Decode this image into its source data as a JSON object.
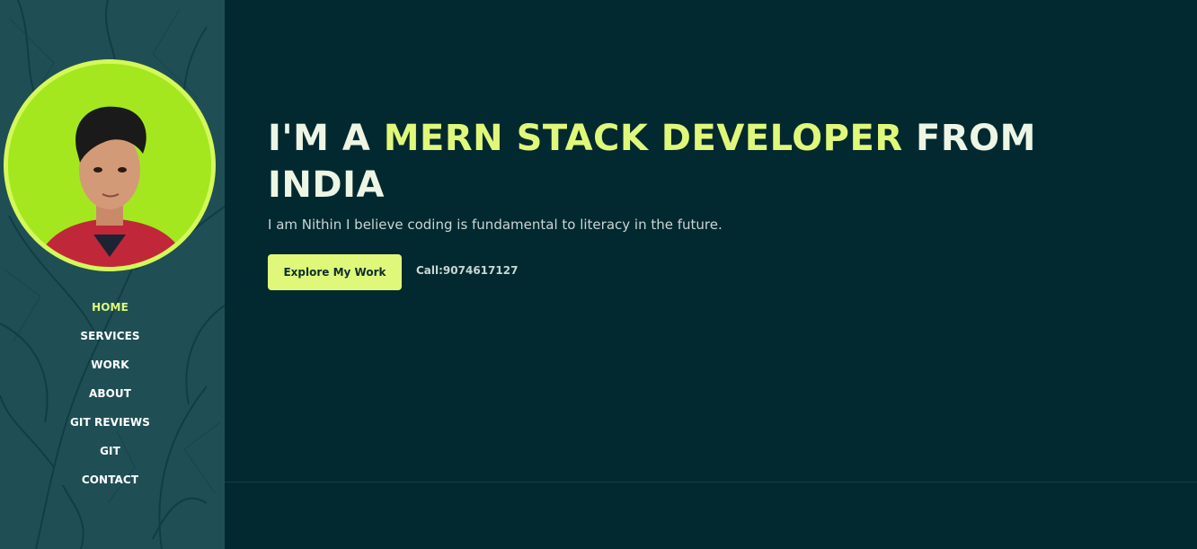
{
  "sidebar": {
    "avatar_alt": "profile photo",
    "nav": [
      {
        "label": "HOME",
        "active": true
      },
      {
        "label": "SERVICES",
        "active": false
      },
      {
        "label": "WORK",
        "active": false
      },
      {
        "label": "ABOUT",
        "active": false
      },
      {
        "label": "GIT REVIEWS",
        "active": false
      },
      {
        "label": "GIT",
        "active": false
      },
      {
        "label": "CONTACT",
        "active": false
      }
    ]
  },
  "hero": {
    "headline_prefix": "I'M A ",
    "headline_accent": "MERN STACK DEVELOPER",
    "headline_suffix": " FROM INDIA",
    "tagline": "I am Nithin I believe coding is fundamental to literacy in the future.",
    "cta_label": "Explore My Work",
    "call_text": "Call:9074617127"
  },
  "colors": {
    "background": "#022930",
    "sidebar": "#1f4f55",
    "accent": "#e0f87a",
    "avatar_bg": "#a4e71f"
  },
  "icons": [
    "tree-background-image",
    "avatar-photo"
  ]
}
